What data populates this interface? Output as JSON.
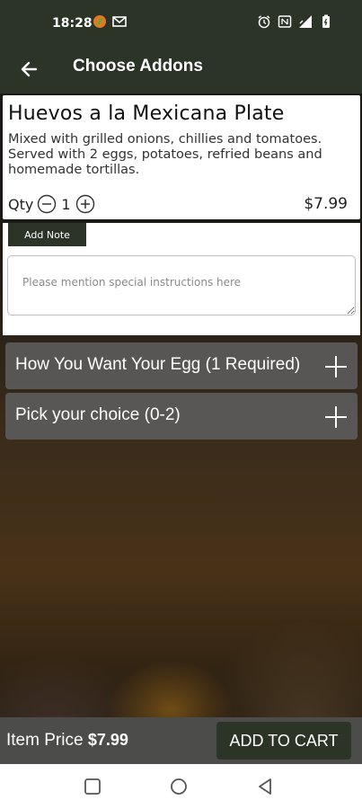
{
  "status_bar": {
    "time": "18:28",
    "icons": [
      "app-notification-icon",
      "gmail-icon",
      "alarm-icon",
      "nfc-icon",
      "signal-icon",
      "battery-icon"
    ]
  },
  "app_bar": {
    "title": "Choose Addons",
    "back_icon": "arrow-left-icon"
  },
  "item": {
    "title": "Huevos a la Mexicana Plate",
    "description": "Mixed with grilled onions, chillies and tomatoes. Served with 2 eggs, potatoes, refried beans and homemade tortillas.",
    "qty_label": "Qty",
    "qty_value": "1",
    "price": "$7.99"
  },
  "note": {
    "label": "Add Note",
    "placeholder": "Please mention special instructions here"
  },
  "addons": [
    {
      "label": "How You Want Your Egg (1 Required)"
    },
    {
      "label": "Pick your choice (0-2)"
    }
  ],
  "footer": {
    "item_price_label": "Item Price",
    "item_price_value": "$7.99",
    "add_to_cart": "ADD TO CART"
  },
  "colors": {
    "brand_dark": "#2c3327",
    "addon_row": "#5c5c5c",
    "footer_bg": "#4c4c4a"
  }
}
